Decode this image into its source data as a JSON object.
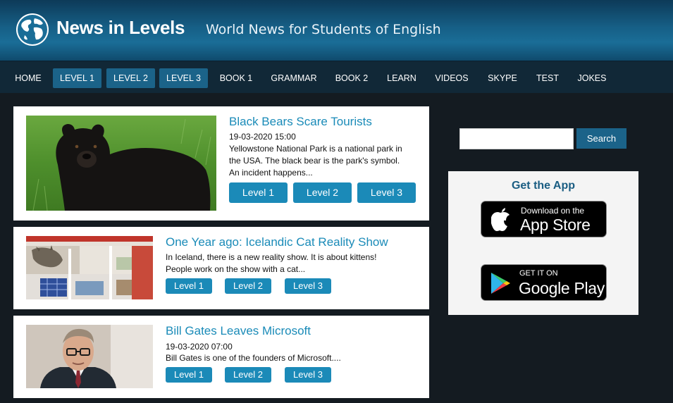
{
  "header": {
    "site_title": "News in Levels",
    "tagline": "World News for Students of English",
    "logo_icon": "globe-icon"
  },
  "nav": {
    "items": [
      {
        "label": "HOME",
        "active": false
      },
      {
        "label": "LEVEL 1",
        "active": true
      },
      {
        "label": "LEVEL 2",
        "active": true
      },
      {
        "label": "LEVEL 3",
        "active": true
      },
      {
        "label": "BOOK 1",
        "active": false
      },
      {
        "label": "GRAMMAR",
        "active": false
      },
      {
        "label": "BOOK 2",
        "active": false
      },
      {
        "label": "LEARN",
        "active": false
      },
      {
        "label": "VIDEOS",
        "active": false
      },
      {
        "label": "SKYPE",
        "active": false
      },
      {
        "label": "TEST",
        "active": false
      },
      {
        "label": "JOKES",
        "active": false
      }
    ]
  },
  "articles": [
    {
      "title": "Black Bears Scare Tourists",
      "date": "19-03-2020 15:00",
      "lines": [
        "Yellowstone National Park is a national park in",
        "the USA. The black bear is the park's symbol.",
        "An incident happens..."
      ],
      "levels": [
        "Level 1",
        "Level 2",
        "Level 3"
      ],
      "image": "black-bear-photo"
    },
    {
      "title": "One Year ago: Icelandic Cat Reality Show",
      "lines": [
        "In Iceland, there is a new reality show. It is about kittens!",
        "People work on the show with a cat..."
      ],
      "levels": [
        "Level 1",
        "Level 2",
        "Level 3"
      ],
      "image": "cat-dollhouse-photo"
    },
    {
      "title": "Bill Gates Leaves Microsoft",
      "date": "19-03-2020 07:00",
      "lines": [
        "Bill Gates is one of the founders of Microsoft...."
      ],
      "levels": [
        "Level 1",
        "Level 2",
        "Level 3"
      ],
      "image": "bill-gates-photo"
    }
  ],
  "sidebar": {
    "search": {
      "value": "",
      "button_label": "Search"
    },
    "app": {
      "heading": "Get the App",
      "app_store": {
        "small": "Download on the",
        "big": "App Store",
        "icon": "apple-icon"
      },
      "google_play": {
        "small": "GET IT ON",
        "big": "Google Play",
        "icon": "google-play-icon"
      }
    }
  },
  "colors": {
    "accent": "#1b8ab8",
    "nav_bg": "#112837",
    "header_blue": "#165f86",
    "title_blue": "#1a8bb8",
    "page_bg": "#141b21"
  }
}
